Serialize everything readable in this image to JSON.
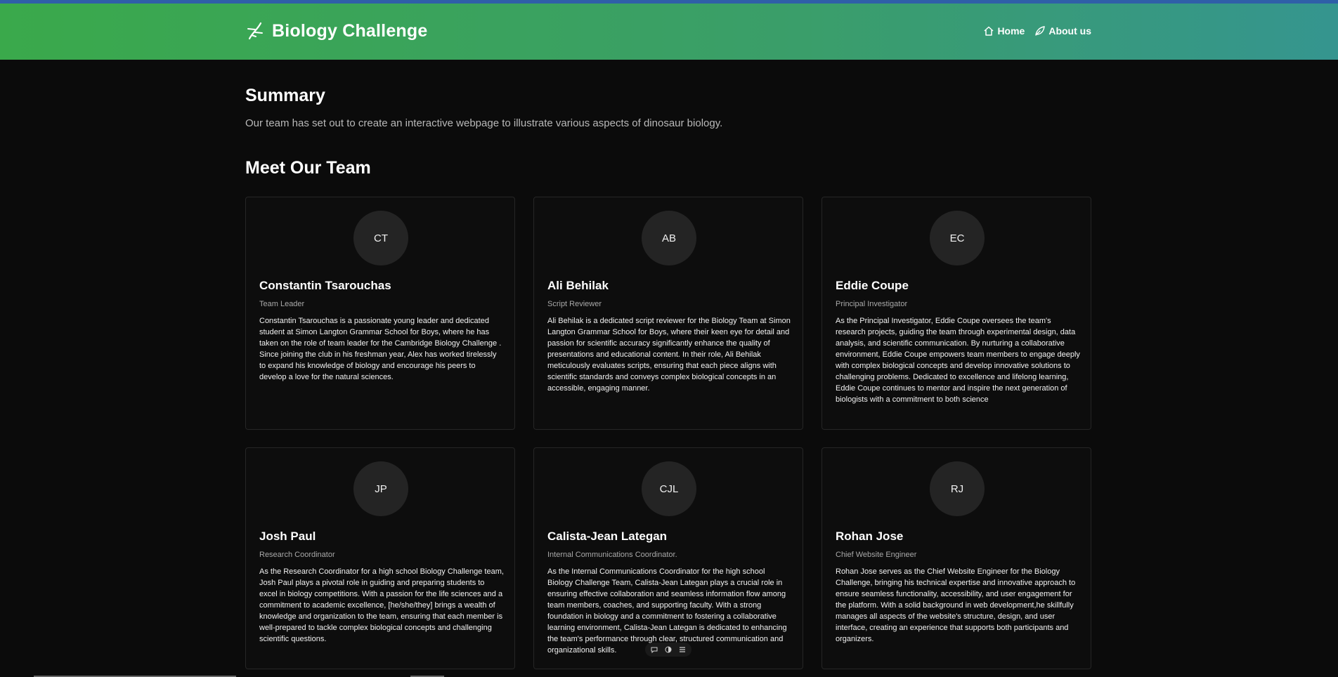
{
  "header": {
    "brand_title": "Biology Challenge",
    "brand_icon": "dna-icon",
    "nav": [
      {
        "label": "Home",
        "icon": "home-icon"
      },
      {
        "label": "About us",
        "icon": "leaf-icon"
      }
    ],
    "colors": {
      "gradient_start": "#3aa94b",
      "gradient_end": "#35958f",
      "top_strip": "#2f5fa8"
    }
  },
  "summary": {
    "title": "Summary",
    "text": "Our team has set out to create an interactive webpage to illustrate various aspects of dinosaur biology."
  },
  "team": {
    "title": "Meet Our Team",
    "members": [
      {
        "initials": "CT",
        "name": "Constantin Tsarouchas",
        "role": "Team Leader",
        "bio": "Constantin Tsarouchas is a passionate young leader and dedicated student at Simon Langton Grammar School for Boys, where he has taken on the role of team leader for the Cambridge Biology Challenge . Since joining the club in his freshman year, Alex has worked tirelessly to expand his knowledge of biology and encourage his peers to develop a love for the natural sciences."
      },
      {
        "initials": "AB",
        "name": "Ali Behilak",
        "role": "Script Reviewer",
        "bio": "Ali Behilak is a dedicated script reviewer for the Biology Team at Simon Langton Grammar School for Boys, where their keen eye for detail and passion for scientific accuracy significantly enhance the quality of presentations and educational content. In their role, Ali Behilak meticulously evaluates scripts, ensuring that each piece aligns with scientific standards and conveys complex biological concepts in an accessible, engaging manner."
      },
      {
        "initials": "EC",
        "name": "Eddie Coupe",
        "role": "Principal Investigator",
        "bio": "As the Principal Investigator, Eddie Coupe oversees the team's research projects, guiding the team through experimental design, data analysis, and scientific communication. By nurturing a collaborative environment, Eddie Coupe empowers team members to engage deeply with complex biological concepts and develop innovative solutions to challenging problems. Dedicated to excellence and lifelong learning, Eddie Coupe continues to mentor and inspire the next generation of biologists with a commitment to both science"
      },
      {
        "initials": "JP",
        "name": "Josh Paul",
        "role": "Research Coordinator",
        "bio": "As the Research Coordinator for a high school Biology Challenge team, Josh Paul plays a pivotal role in guiding and preparing students to excel in biology competitions. With a passion for the life sciences and a commitment to academic excellence, [he/she/they] brings a wealth of knowledge and organization to the team, ensuring that each member is well-prepared to tackle complex biological concepts and challenging scientific questions."
      },
      {
        "initials": "CJL",
        "name": "Calista-Jean Lategan",
        "role": "Internal Communications Coordinator.",
        "bio": "As the Internal Communications Coordinator for the high school Biology Challenge Team, Calista-Jean Lategan plays a crucial role in ensuring effective collaboration and seamless information flow among team members, coaches, and supporting faculty. With a strong foundation in biology and a commitment to fostering a collaborative learning environment, Calista-Jean Lategan is dedicated to enhancing the team's performance through clear, structured communication and organizational skills."
      },
      {
        "initials": "RJ",
        "name": "Rohan Jose",
        "role": "Chief Website Engineer",
        "bio": "Rohan Jose serves as the Chief Website Engineer for the Biology Challenge, bringing his technical expertise and innovative approach to ensure seamless functionality, accessibility, and user engagement for the platform. With a solid background in web development,he skillfully manages all aspects of the website's structure, design, and user interface, creating an experience that supports both participants and organizers."
      }
    ]
  },
  "floating_toolbar": {
    "icons": [
      "comment-icon",
      "contrast-icon",
      "menu-icon"
    ]
  }
}
